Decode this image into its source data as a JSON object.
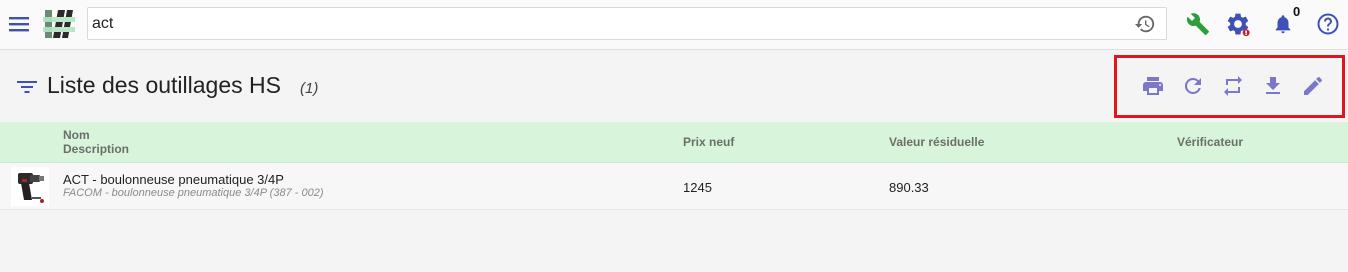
{
  "topbar": {
    "search_value": "act",
    "notification_count": "0"
  },
  "header": {
    "title": "Liste des outillages HS",
    "count": "(1)"
  },
  "table": {
    "columns": {
      "name": "Nom",
      "description": "Description",
      "price": "Prix neuf",
      "residual": "Valeur résiduelle",
      "verifier": "Vérificateur"
    },
    "rows": [
      {
        "name": "ACT - boulonneuse pneumatique 3/4P",
        "description": "FACOM - boulonneuse pneumatique 3/4P (387 - 002)",
        "price": "1245",
        "residual": "890.33",
        "verifier": ""
      }
    ]
  },
  "colors": {
    "accent": "#3f51b5",
    "action_icon": "#7b78c9",
    "wrench": "#2e9e3c",
    "table_header_bg": "#d8f5dc",
    "highlight_border": "#e0161f"
  },
  "icons": {
    "menu": "hamburger-menu-icon",
    "logo": "hashtag-logo",
    "history": "history-icon",
    "wrench": "wrench-icon",
    "settings": "gear-icon",
    "notifications": "bell-icon",
    "help": "help-icon",
    "filter": "filter-icon",
    "print": "print-icon",
    "refresh": "refresh-icon",
    "swap": "repeat-icon",
    "download": "download-icon",
    "edit": "edit-icon"
  }
}
